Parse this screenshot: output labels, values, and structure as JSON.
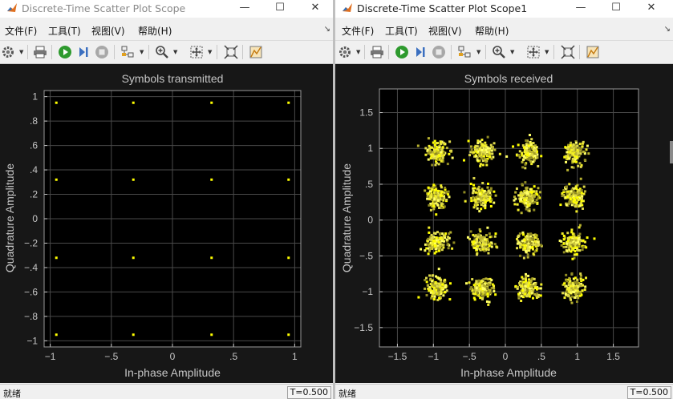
{
  "windows": [
    {
      "title": "Discrete-Time Scatter Plot Scope",
      "menu": [
        "文件(F)",
        "工具(T)",
        "视图(V)",
        "帮助(H)"
      ],
      "status_left": "就绪",
      "status_right": "T=0.500",
      "window_buttons": {
        "minimize": "—",
        "maximize": "☐",
        "close": "✕"
      }
    },
    {
      "title": "Discrete-Time Scatter Plot Scope1",
      "menu": [
        "文件(F)",
        "工具(T)",
        "视图(V)",
        "帮助(H)"
      ],
      "status_left": "就绪",
      "status_right": "T=0.500",
      "window_buttons": {
        "minimize": "—",
        "maximize": "☐",
        "close": "✕"
      }
    }
  ],
  "toolbar_icons": [
    "gear-icon",
    "print-icon",
    "run-icon",
    "step-forward-icon",
    "stop-icon",
    "highlight-icon",
    "zoom-in-icon",
    "fit-view-icon",
    "scale-axes-icon",
    "measurements-icon"
  ],
  "colors": {
    "plot_bg": "#171717",
    "axes_bg": "#000000",
    "grid": "#4a4a4a",
    "axis_text": "#c6c6c6",
    "marker": "#ffff00"
  },
  "chart_data": [
    {
      "type": "scatter",
      "title": "Symbols transmitted",
      "xlabel": "In-phase Amplitude",
      "ylabel": "Quadrature Amplitude",
      "xlim": [
        -1.05,
        1.05
      ],
      "ylim": [
        -1.05,
        1.05
      ],
      "xticks": [
        -1,
        -0.5,
        0,
        0.5,
        1
      ],
      "yticks": [
        1,
        0.8,
        0.6,
        0.4,
        0.2,
        0,
        -0.2,
        -0.4,
        -0.6,
        -0.8,
        -1
      ],
      "grid": true,
      "series": [
        {
          "points": [
            [
              -0.95,
              0.95
            ],
            [
              -0.32,
              0.95
            ],
            [
              0.32,
              0.95
            ],
            [
              0.95,
              0.95
            ],
            [
              -0.95,
              0.32
            ],
            [
              -0.32,
              0.32
            ],
            [
              0.32,
              0.32
            ],
            [
              0.95,
              0.32
            ],
            [
              -0.95,
              -0.32
            ],
            [
              -0.32,
              -0.32
            ],
            [
              0.32,
              -0.32
            ],
            [
              0.95,
              -0.32
            ],
            [
              -0.95,
              -0.95
            ],
            [
              -0.32,
              -0.95
            ],
            [
              0.32,
              -0.95
            ],
            [
              0.95,
              -0.95
            ]
          ]
        }
      ]
    },
    {
      "type": "scatter",
      "title": "Symbols received",
      "xlabel": "In-phase Amplitude",
      "ylabel": "Quadrature Amplitude",
      "xlim": [
        -1.75,
        1.85
      ],
      "ylim": [
        -1.77,
        1.83
      ],
      "xticks": [
        -1.5,
        -1,
        -0.5,
        0,
        0.5,
        1,
        1.5
      ],
      "yticks": [
        1.5,
        1,
        0.5,
        0,
        -0.5,
        -1,
        -1.5
      ],
      "grid": true,
      "series": [
        {
          "cluster_centers": [
            [
              -0.95,
              0.95
            ],
            [
              -0.32,
              0.95
            ],
            [
              0.32,
              0.95
            ],
            [
              0.95,
              0.95
            ],
            [
              -0.95,
              0.32
            ],
            [
              -0.32,
              0.32
            ],
            [
              0.32,
              0.32
            ],
            [
              0.95,
              0.32
            ],
            [
              -0.95,
              -0.32
            ],
            [
              -0.32,
              -0.32
            ],
            [
              0.32,
              -0.32
            ],
            [
              0.95,
              -0.32
            ],
            [
              -0.95,
              -0.95
            ],
            [
              -0.32,
              -0.95
            ],
            [
              0.32,
              -0.95
            ],
            [
              0.95,
              -0.95
            ]
          ],
          "noise_std": 0.075
        }
      ]
    }
  ]
}
